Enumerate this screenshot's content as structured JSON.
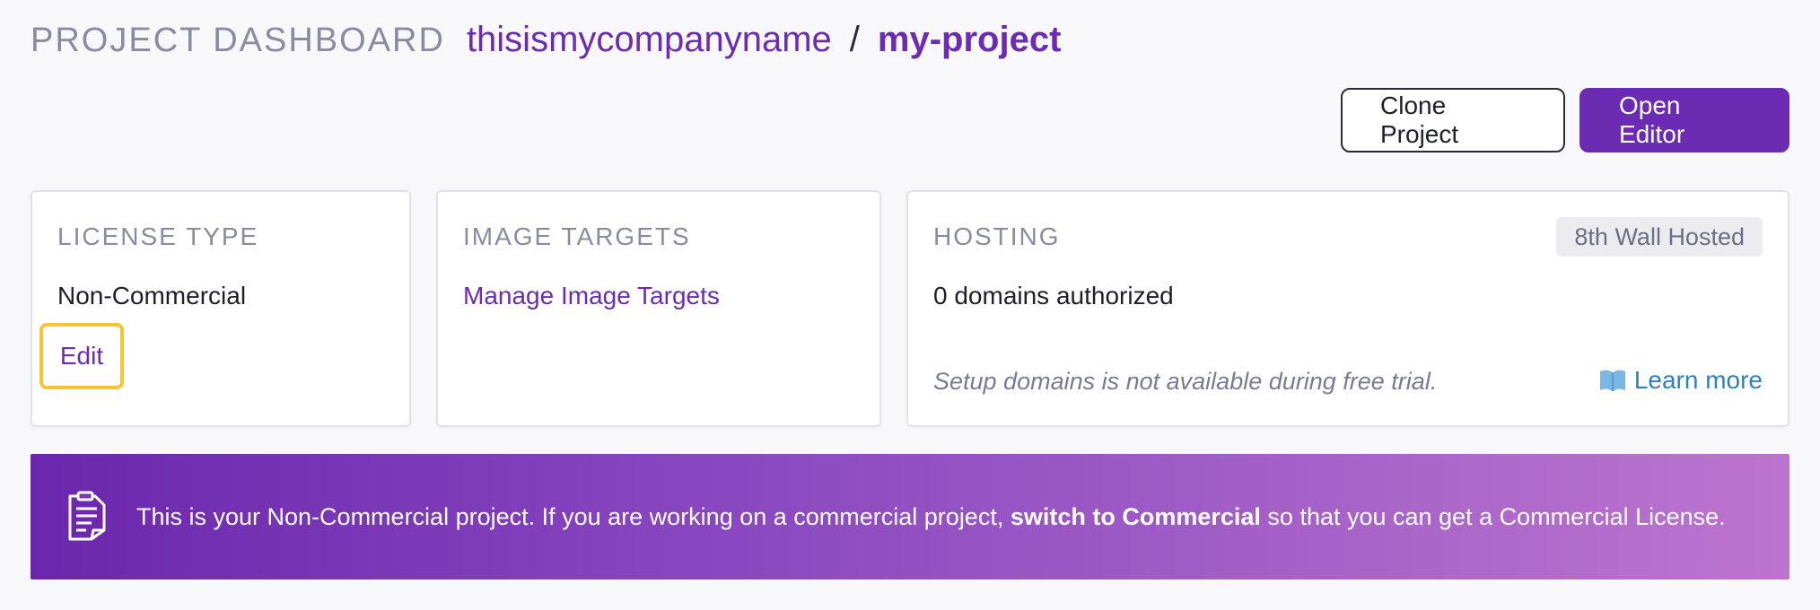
{
  "header": {
    "dashboard_label": "PROJECT DASHBOARD",
    "company": "thisismycompanyname",
    "separator": "/",
    "project": "my-project"
  },
  "actions": {
    "clone_label": "Clone Project",
    "open_editor_label": "Open Editor"
  },
  "license_card": {
    "title": "LICENSE TYPE",
    "value": "Non-Commercial",
    "edit_label": "Edit"
  },
  "targets_card": {
    "title": "IMAGE TARGETS",
    "link_label": "Manage Image Targets"
  },
  "hosting_card": {
    "title": "HOSTING",
    "badge": "8th Wall Hosted",
    "domains": "0 domains authorized",
    "note": "Setup domains is not available during free trial.",
    "learn_more_label": "Learn more",
    "learn_more_icon": "book-icon"
  },
  "banner": {
    "icon": "license-document-icon",
    "text_before": "This is your Non-Commercial project. If you are working on a commercial project, ",
    "text_bold": "switch to Commercial",
    "text_after": " so that you can get a Commercial License."
  },
  "colors": {
    "accent": "#6b2bb3",
    "highlight": "#f7c531",
    "link_blue": "#2f82b8",
    "muted": "#8a8aa0"
  }
}
